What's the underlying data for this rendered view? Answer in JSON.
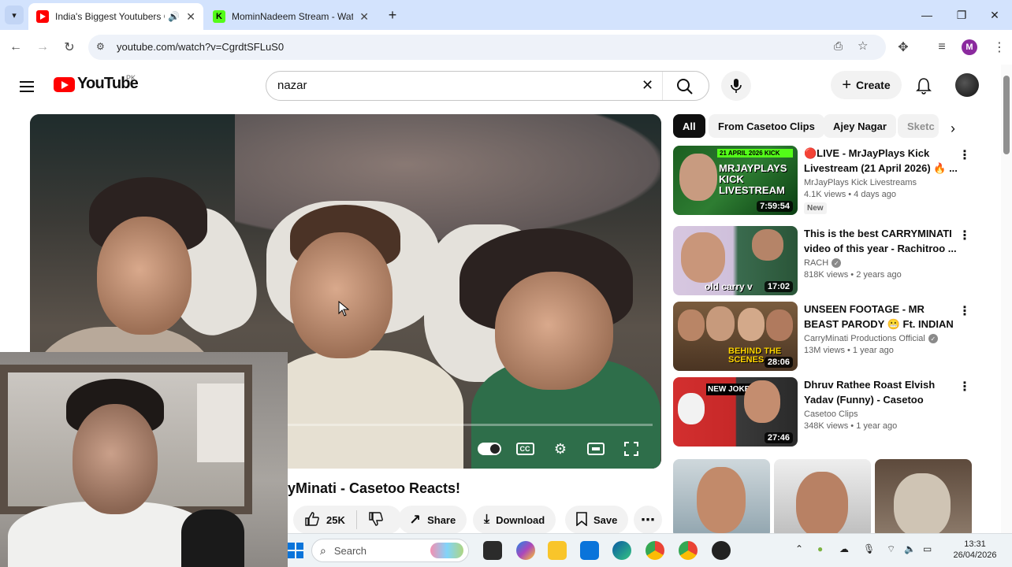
{
  "browser": {
    "tabs": [
      {
        "title": "India's Biggest Youtubers Co",
        "active": true
      },
      {
        "title": "MominNadeem Stream - Watch",
        "active": false
      }
    ],
    "url": "youtube.com/watch?v=CgrdtSFLuS0",
    "profile_initial": "M"
  },
  "youtube": {
    "logo_text": "YouTube",
    "country_code": "PK",
    "search_query": "nazar",
    "create_label": "Create"
  },
  "video": {
    "title_visible": "yMinati - Casetoo Reacts!",
    "likes": "25K",
    "share_label": "Share",
    "download_label": "Download",
    "save_label": "Save"
  },
  "chips": [
    "All",
    "From Casetoo Clips",
    "Ajey Nagar",
    "Sketc"
  ],
  "recommendations": [
    {
      "title": "🔴LIVE - MrJayPlays Kick Livestream (21 April 2026) 🔥 ...",
      "channel": "MrJayPlays Kick Livestreams",
      "stats": "4.1K views • 4 days ago",
      "duration": "7:59:54",
      "badge": "New",
      "verified": false,
      "thumb_text": "MRJAYPLAYS KICK LIVESTREAM",
      "thumb_top_text": "21 APRIL 2026 KICK"
    },
    {
      "title": "This is the best CARRYMINATI video of this year - Rachitroo ...",
      "channel": "RACH",
      "stats": "818K views • 2 years ago",
      "duration": "17:02",
      "badge": "",
      "verified": true,
      "thumb_text": "old carry v"
    },
    {
      "title": "UNSEEN FOOTAGE - MR BEAST PARODY 😬 Ft. INDIAN ...",
      "channel": "CarryMinati Productions Official",
      "stats": "13M views • 1 year ago",
      "duration": "28:06",
      "badge": "",
      "verified": true,
      "thumb_text": "BEHIND THE SCENES"
    },
    {
      "title": "Dhruv Rathee Roast Elvish Yadav (Funny) - Casetoo React...",
      "channel": "Casetoo Clips",
      "stats": "348K views • 1 year ago",
      "duration": "27:46",
      "badge": "",
      "verified": false,
      "thumb_text": "NEW JOKER"
    }
  ],
  "taskbar": {
    "search_placeholder": "Search",
    "time": "13:31",
    "date": "26/04/2026"
  }
}
